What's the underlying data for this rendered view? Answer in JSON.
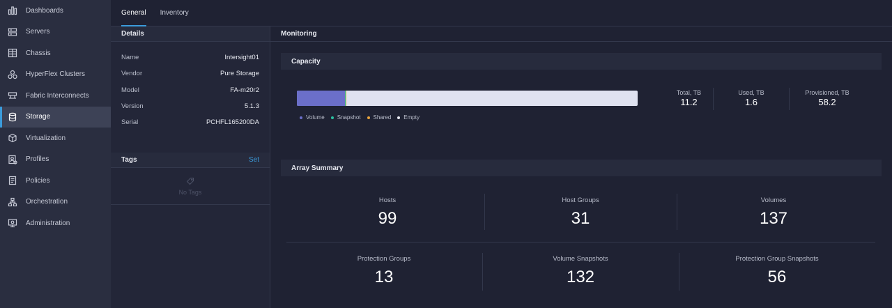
{
  "sidebar": {
    "items": [
      {
        "label": "Dashboards",
        "icon": "bar-chart-icon"
      },
      {
        "label": "Servers",
        "icon": "server-icon"
      },
      {
        "label": "Chassis",
        "icon": "chassis-icon"
      },
      {
        "label": "HyperFlex Clusters",
        "icon": "cluster-icon"
      },
      {
        "label": "Fabric Interconnects",
        "icon": "fabric-icon"
      },
      {
        "label": "Storage",
        "icon": "storage-icon",
        "active": true
      },
      {
        "label": "Virtualization",
        "icon": "cube-icon"
      },
      {
        "label": "Profiles",
        "icon": "profile-icon"
      },
      {
        "label": "Policies",
        "icon": "policy-icon"
      },
      {
        "label": "Orchestration",
        "icon": "workflow-icon"
      },
      {
        "label": "Administration",
        "icon": "admin-icon"
      }
    ]
  },
  "tabs": [
    {
      "label": "General",
      "active": true
    },
    {
      "label": "Inventory"
    }
  ],
  "details": {
    "title": "Details",
    "rows": [
      {
        "key": "Name",
        "value": "Intersight01"
      },
      {
        "key": "Vendor",
        "value": "Pure Storage"
      },
      {
        "key": "Model",
        "value": "FA-m20r2"
      },
      {
        "key": "Version",
        "value": "5.1.3"
      },
      {
        "key": "Serial",
        "value": "PCHFL165200DA"
      }
    ]
  },
  "tags": {
    "title": "Tags",
    "action": "Set",
    "empty_text": "No Tags"
  },
  "monitoring": {
    "title": "Monitoring",
    "capacity": {
      "title": "Capacity",
      "bar": {
        "volume_fraction": 0.141,
        "snapshot_fraction": 0.003,
        "shared_fraction": 0.002
      },
      "legend": [
        {
          "label": "Volume",
          "color": "#6b6fc9"
        },
        {
          "label": "Snapshot",
          "color": "#2cbfa0"
        },
        {
          "label": "Shared",
          "color": "#e8a33d"
        },
        {
          "label": "Empty",
          "color": "#e8eaf3"
        }
      ],
      "stats": [
        {
          "label": "Total, TB",
          "value": "11.2"
        },
        {
          "label": "Used, TB",
          "value": "1.6"
        },
        {
          "label": "Provisioned, TB",
          "value": "58.2"
        }
      ]
    },
    "array_summary": {
      "title": "Array Summary",
      "stats": [
        {
          "label": "Hosts",
          "value": "99"
        },
        {
          "label": "Host Groups",
          "value": "31"
        },
        {
          "label": "Volumes",
          "value": "137"
        },
        {
          "label": "Protection Groups",
          "value": "13"
        },
        {
          "label": "Volume Snapshots",
          "value": "132"
        },
        {
          "label": "Protection Group Snapshots",
          "value": "56"
        }
      ]
    }
  }
}
